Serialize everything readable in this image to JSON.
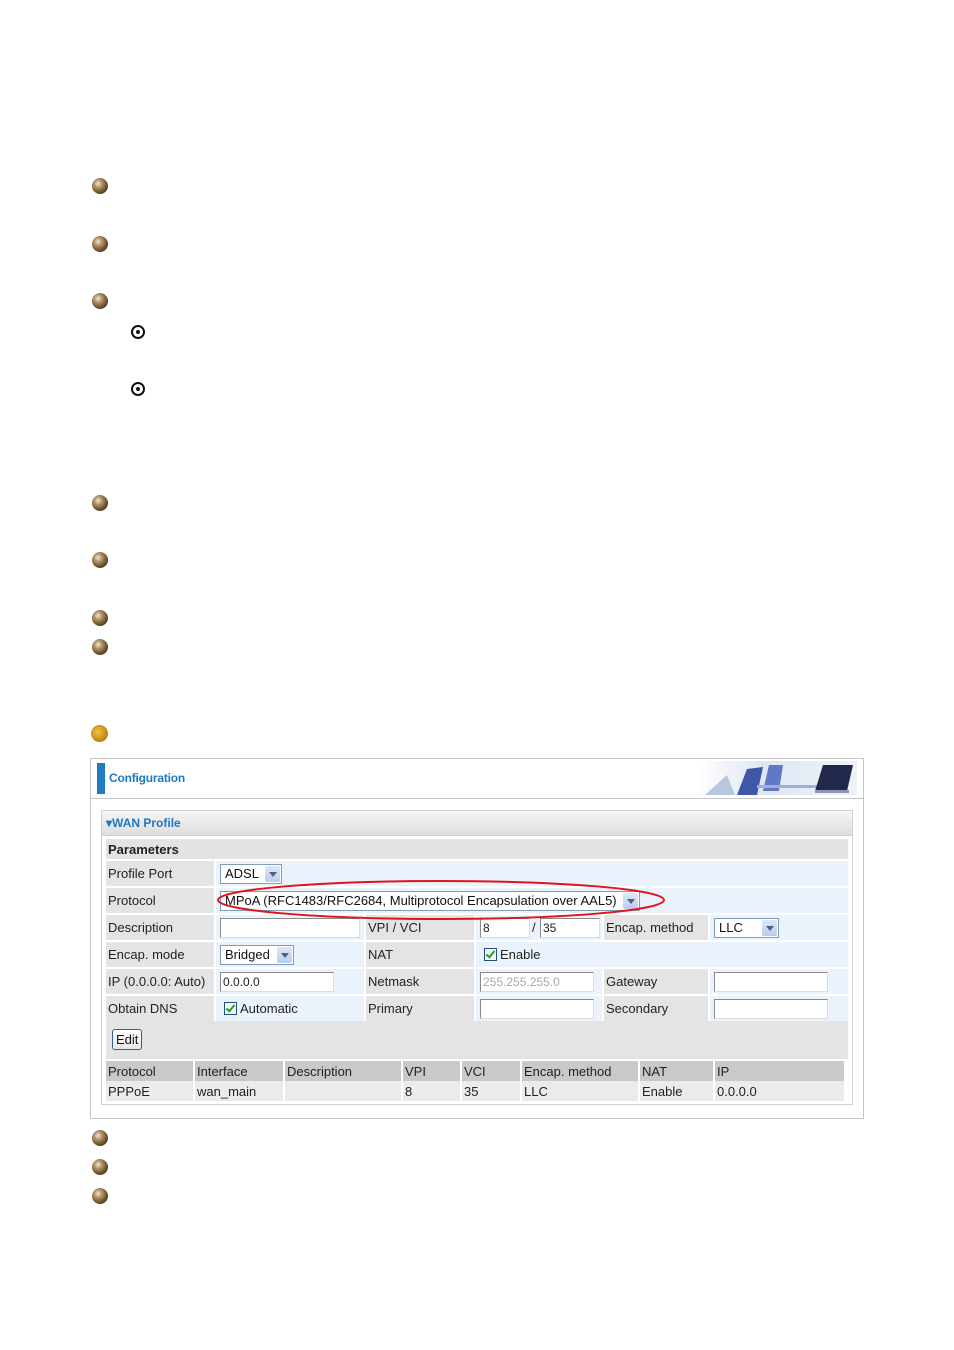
{
  "bullets": {
    "top_group": [
      "bullet",
      "bullet",
      "bullet"
    ],
    "sub_items": [
      "radio-bullet",
      "radio-bullet"
    ],
    "middle_group": [
      "bullet",
      "bullet",
      "bullet",
      "bullet"
    ],
    "note_icon": "gold-bullet",
    "bottom_group": [
      "bullet",
      "bullet",
      "bullet"
    ]
  },
  "config": {
    "title": "Configuration",
    "panel_title": "WAN Profile",
    "section_title": "Parameters",
    "fields": {
      "profile_port": {
        "label": "Profile Port",
        "value": "ADSL"
      },
      "protocol": {
        "label": "Protocol",
        "value": "MPoA (RFC1483/RFC2684, Multiprotocol Encapsulation over AAL5)"
      },
      "description": {
        "label": "Description",
        "value": ""
      },
      "vpi_vci": {
        "label": "VPI / VCI",
        "vpi": "8",
        "separator": "/",
        "vci": "35"
      },
      "encap_method": {
        "label": "Encap. method",
        "value": "LLC"
      },
      "encap_mode": {
        "label": "Encap. mode",
        "value": "Bridged"
      },
      "nat": {
        "label": "NAT",
        "checkbox_label": "Enable",
        "checked": true
      },
      "ip": {
        "label": "IP (0.0.0.0: Auto)",
        "value": "0.0.0.0"
      },
      "netmask": {
        "label": "Netmask",
        "value": "255.255.255.0"
      },
      "gateway": {
        "label": "Gateway",
        "value": ""
      },
      "obtain_dns": {
        "label": "Obtain DNS",
        "checkbox_label": "Automatic",
        "checked": true
      },
      "primary": {
        "label": "Primary",
        "value": ""
      },
      "secondary": {
        "label": "Secondary",
        "value": ""
      }
    },
    "edit_button": "Edit",
    "table": {
      "headers": [
        "Protocol",
        "Interface",
        "Description",
        "VPI",
        "VCI",
        "Encap. method",
        "NAT",
        "IP"
      ],
      "rows": [
        [
          "PPPoE",
          "wan_main",
          "",
          "8",
          "35",
          "LLC",
          "Enable",
          "0.0.0.0"
        ]
      ]
    },
    "highlight_color": "#e0151b",
    "accent_color": "#1f78c1"
  }
}
